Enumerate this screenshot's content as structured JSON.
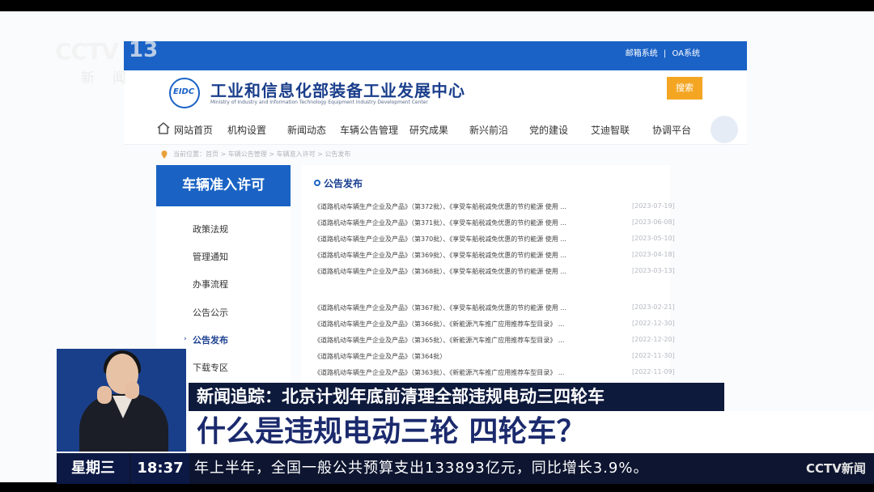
{
  "website": {
    "top_links": [
      "邮箱系统",
      "|",
      "OA系统"
    ],
    "logo_text": "EIDC",
    "title": "工业和信息化部装备工业发展中心",
    "subtitle": "Ministry of Industry and Information Technology Equipment Industry Development Center",
    "search_label": "搜索",
    "nav": [
      "网站首页",
      "机构设置",
      "新闻动态",
      "车辆公告管理",
      "研究成果",
      "新兴前沿",
      "党的建设",
      "艾迪智联",
      "协调平台"
    ],
    "breadcrumb": "当前位置：首页 > 车辆公告管理 > 车辆准入许可 > 公告发布",
    "sidebar": {
      "title": "车辆准入许可",
      "items": [
        "政策法规",
        "管理通知",
        "办事流程",
        "公告公示",
        "公告发布",
        "下载专区"
      ],
      "active": "公告发布"
    },
    "list": {
      "title": "公告发布",
      "rows": [
        {
          "text": "《道路机动车辆生产企业及产品》（第372批）、《享受车船税减免优惠的节约能源 使用 ...",
          "date": "[2023-07-19]"
        },
        {
          "text": "《道路机动车辆生产企业及产品》（第371批）、《享受车船税减免优惠的节约能源 使用 ...",
          "date": "[2023-06-08]"
        },
        {
          "text": "《道路机动车辆生产企业及产品》（第370批）、《享受车船税减免优惠的节约能源 使用 ...",
          "date": "[2023-05-10]"
        },
        {
          "text": "《道路机动车辆生产企业及产品》（第369批）、《享受车船税减免优惠的节约能源 使用 ...",
          "date": "[2023-04-18]"
        },
        {
          "text": "《道路机动车辆生产企业及产品》（第368批）、《享受车船税减免优惠的节约能源 使用 ...",
          "date": "[2023-03-13]"
        },
        {
          "text": "《道路机动车辆生产企业及产品》（第367批）、《享受车船税减免优惠的节约能源 使用 ...",
          "date": "[2023-02-21]"
        },
        {
          "text": "《道路机动车辆生产企业及产品》（第366批）、《新能源汽车推广应用推荐车型目录》 ...",
          "date": "[2022-12-30]"
        },
        {
          "text": "《道路机动车辆生产企业及产品》（第365批）、《新能源汽车推广应用推荐车型目录》 ...",
          "date": "[2022-12-20]"
        },
        {
          "text": "《道路机动车辆生产企业及产品》（第364批）",
          "date": "[2022-11-30]"
        },
        {
          "text": "《道路机动车辆生产企业及产品》（第363批）、《新能源汽车推广应用推荐车型目录》 ...",
          "date": "[2022-11-09]"
        }
      ]
    }
  },
  "broadcast": {
    "channel_logo": "CCTV",
    "channel_number": "13",
    "channel_name": "新闻",
    "headline_small": "新闻追踪：北京计划年底前清理全部违规电动三四轮车",
    "headline_big": "什么是违规电动三轮 四轮车？",
    "weekday": "星期三",
    "time": "18:37",
    "ticker": "年上半年，全国一般公共预算支出133893亿元，同比增长3.9%。",
    "ticker_logo": "CCTV新闻"
  }
}
